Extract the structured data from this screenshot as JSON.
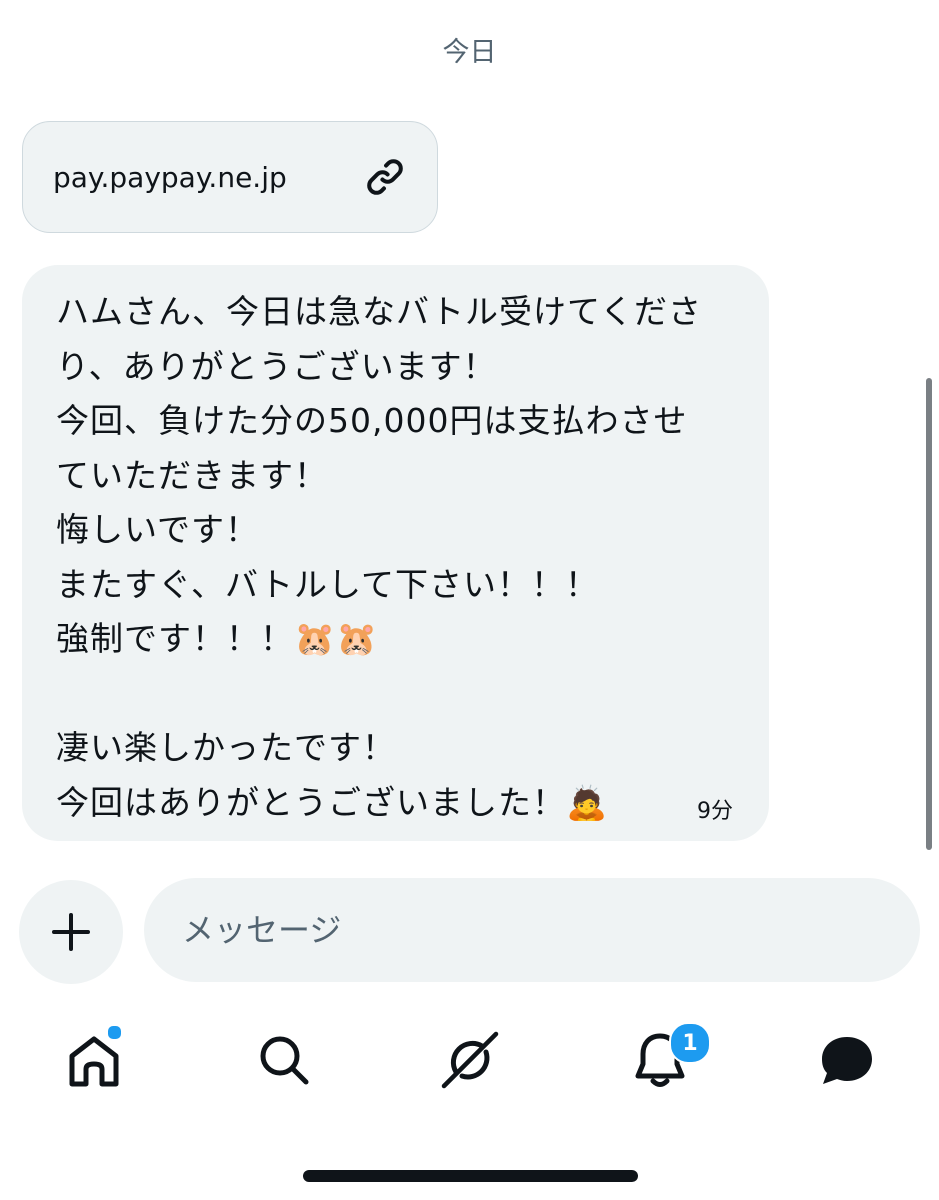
{
  "conversation": {
    "date_separator": "今日",
    "link_preview": {
      "domain": "pay.paypay.ne.jp",
      "icon": "link-icon"
    },
    "message": {
      "lines": [
        "ハムさん、今日は急なバトル受けてくださ",
        "り、ありがとうございます！",
        "今回、負けた分の50,000円は支払わさせ",
        "ていただきます！",
        "悔しいです！",
        "またすぐ、バトルして下さい！！！",
        "強制です！！！🐹🐹",
        "",
        "凄い楽しかったです！",
        "今回はありがとうございました！🙇"
      ],
      "timestamp": "9分"
    }
  },
  "composer": {
    "add_icon": "plus-icon",
    "placeholder": "メッセージ"
  },
  "tabbar": {
    "items": [
      {
        "name": "home",
        "icon": "home-icon",
        "has_dot": true
      },
      {
        "name": "search",
        "icon": "search-icon"
      },
      {
        "name": "grok",
        "icon": "grok-icon"
      },
      {
        "name": "notifications",
        "icon": "bell-icon",
        "badge": "1"
      },
      {
        "name": "messages",
        "icon": "message-icon",
        "active": true
      }
    ]
  },
  "colors": {
    "accent": "#1d9bf0",
    "bubble_bg": "#eff3f4",
    "text_primary": "#0f1419",
    "text_secondary": "#536471"
  }
}
